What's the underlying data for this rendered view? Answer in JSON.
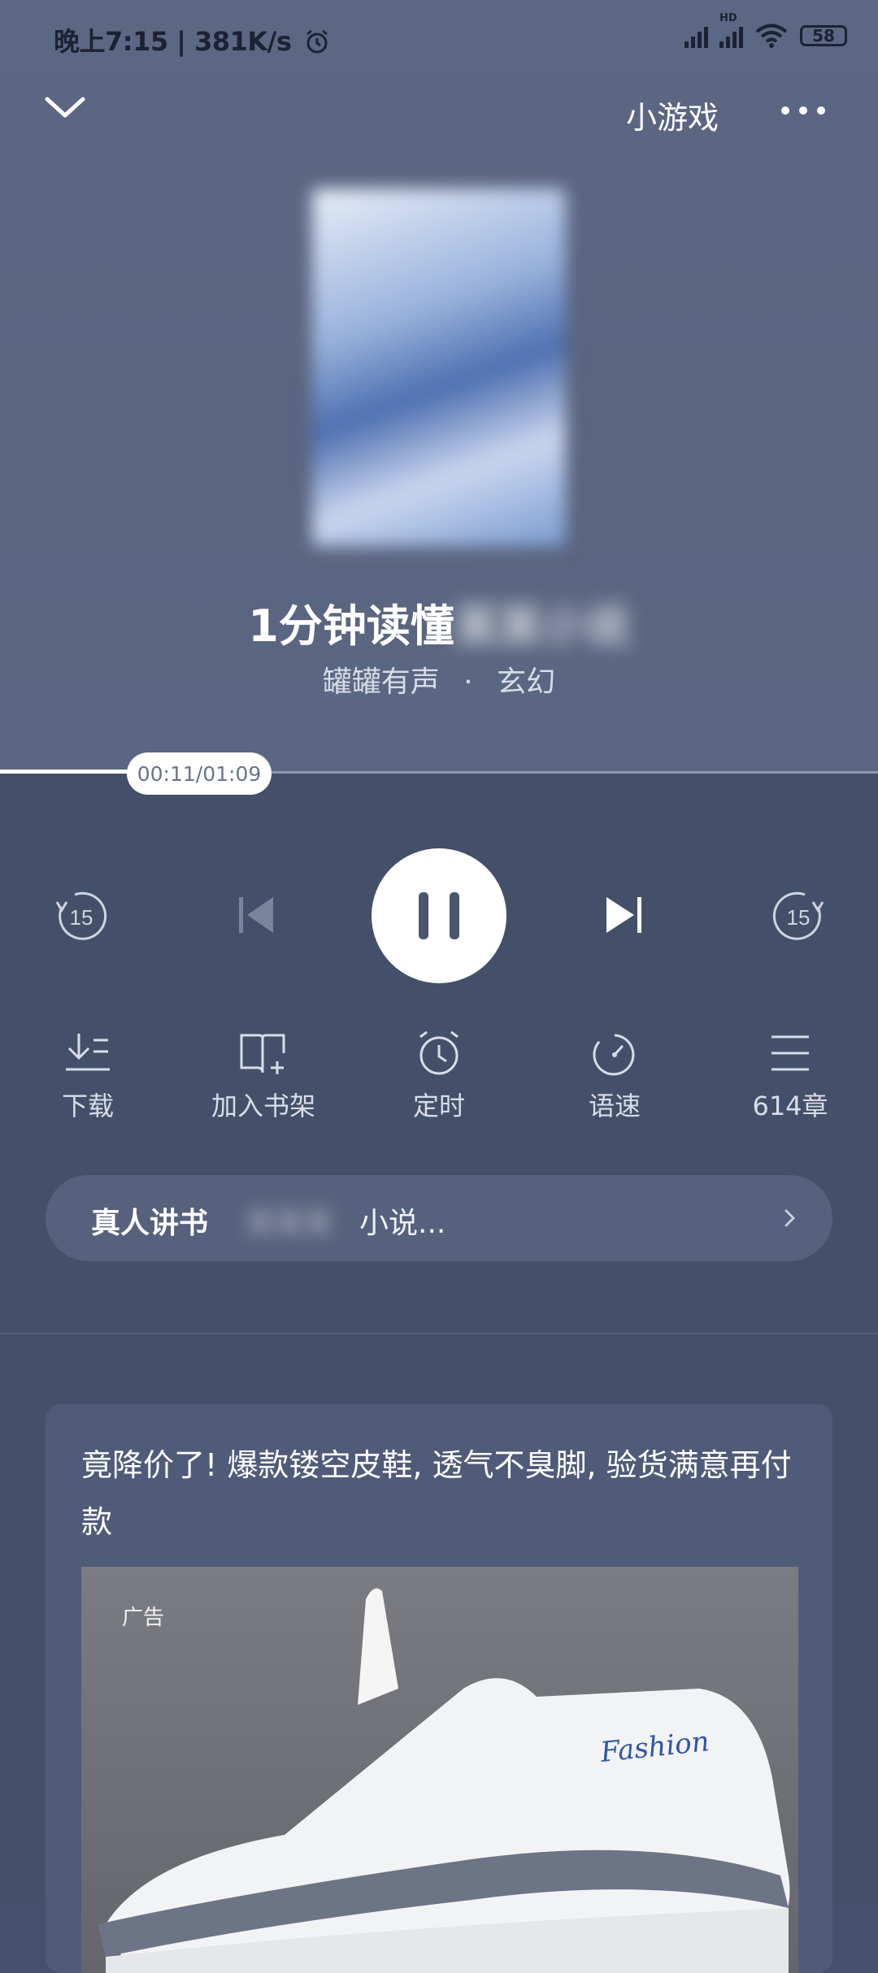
{
  "status_bar": {
    "time_speed": "晚上7:15 | 381K/s",
    "network_badge": "HD",
    "battery": "58"
  },
  "header": {
    "mini_games_label": "小游戏"
  },
  "book": {
    "title_visible": "1分钟读懂",
    "title_obscured": "某某小说",
    "author": "罐罐有声",
    "separator": "·",
    "genre": "玄幻"
  },
  "player": {
    "time_display": "00:11/01:09",
    "progress_fraction": 0.16,
    "rewind_label": "15",
    "forward_label": "15",
    "state": "playing"
  },
  "actions": [
    {
      "label": "下载",
      "icon": "download-icon"
    },
    {
      "label": "加入书架",
      "icon": "add-bookshelf-icon"
    },
    {
      "label": "定时",
      "icon": "alarm-timer-icon"
    },
    {
      "label": "语速",
      "icon": "speed-icon"
    },
    {
      "label": "614章",
      "icon": "chapter-list-icon"
    }
  ],
  "narration": {
    "title": "真人讲书",
    "obscured": "某某某",
    "text": "小说..."
  },
  "ad": {
    "headline": "竟降价了! 爆款镂空皮鞋, 透气不臭脚, 验货满意再付款",
    "label": "广告",
    "shoe_brand": "Fashion"
  },
  "colors": {
    "top_bg": "#5c6784",
    "bottom_bg": "#445069",
    "accent": "#ffffff"
  }
}
